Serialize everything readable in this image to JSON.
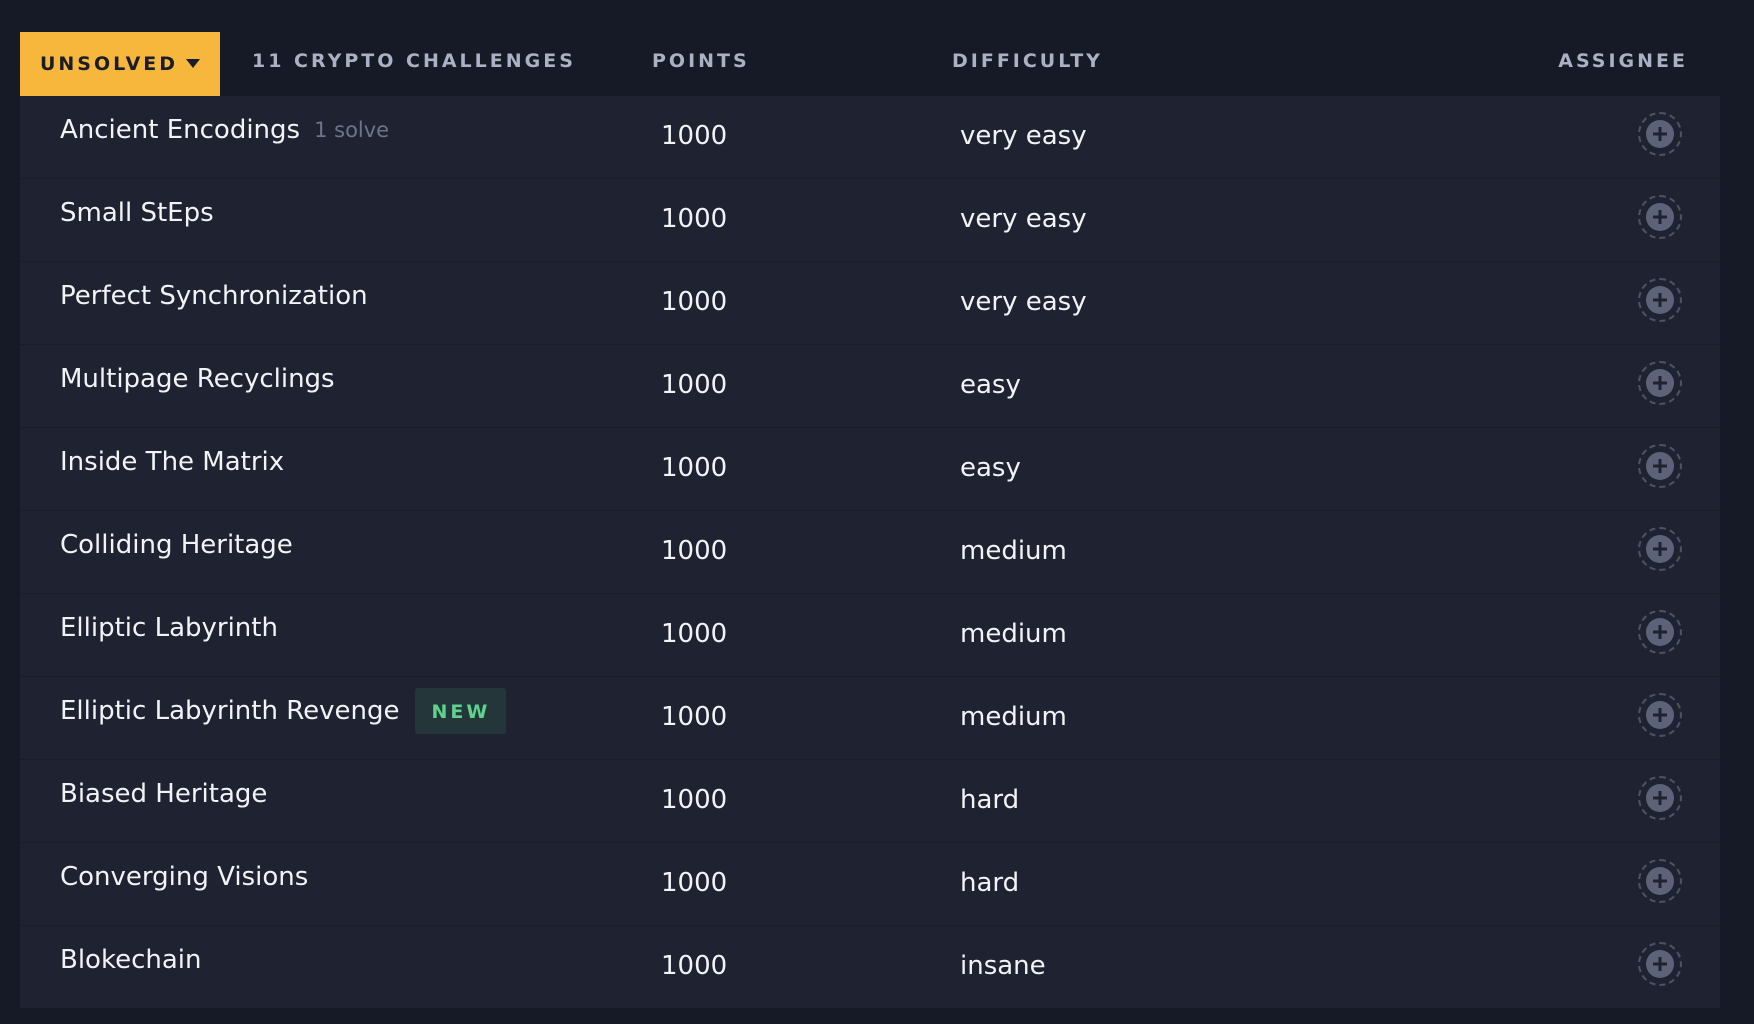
{
  "header": {
    "filter_label": "UNSOLVED",
    "challenge_count_label": "11 CRYPTO CHALLENGES",
    "points_header": "POINTS",
    "difficulty_header": "DIFFICULTY",
    "assignee_header": "ASSIGNEE"
  },
  "colors": {
    "background": "#161a26",
    "table_background": "#1f2331",
    "accent": "#f6b73c",
    "new_badge_text": "#5fd38d",
    "new_badge_background": "#24363a"
  },
  "icons": {
    "filter_caret": "caret-down-icon",
    "assign": "add-circle-icon"
  },
  "challenges": [
    {
      "name": "Ancient Encodings",
      "solves": "1 solve",
      "badge": "",
      "points": "1000",
      "difficulty": "very easy"
    },
    {
      "name": "Small StEps",
      "solves": "",
      "badge": "",
      "points": "1000",
      "difficulty": "very easy"
    },
    {
      "name": "Perfect Synchronization",
      "solves": "",
      "badge": "",
      "points": "1000",
      "difficulty": "very easy"
    },
    {
      "name": "Multipage Recyclings",
      "solves": "",
      "badge": "",
      "points": "1000",
      "difficulty": "easy"
    },
    {
      "name": "Inside The Matrix",
      "solves": "",
      "badge": "",
      "points": "1000",
      "difficulty": "easy"
    },
    {
      "name": "Colliding Heritage",
      "solves": "",
      "badge": "",
      "points": "1000",
      "difficulty": "medium"
    },
    {
      "name": "Elliptic Labyrinth",
      "solves": "",
      "badge": "",
      "points": "1000",
      "difficulty": "medium"
    },
    {
      "name": "Elliptic Labyrinth Revenge",
      "solves": "",
      "badge": "NEW",
      "points": "1000",
      "difficulty": "medium"
    },
    {
      "name": "Biased Heritage",
      "solves": "",
      "badge": "",
      "points": "1000",
      "difficulty": "hard"
    },
    {
      "name": "Converging Visions",
      "solves": "",
      "badge": "",
      "points": "1000",
      "difficulty": "hard"
    },
    {
      "name": "Blokechain",
      "solves": "",
      "badge": "",
      "points": "1000",
      "difficulty": "insane"
    }
  ]
}
